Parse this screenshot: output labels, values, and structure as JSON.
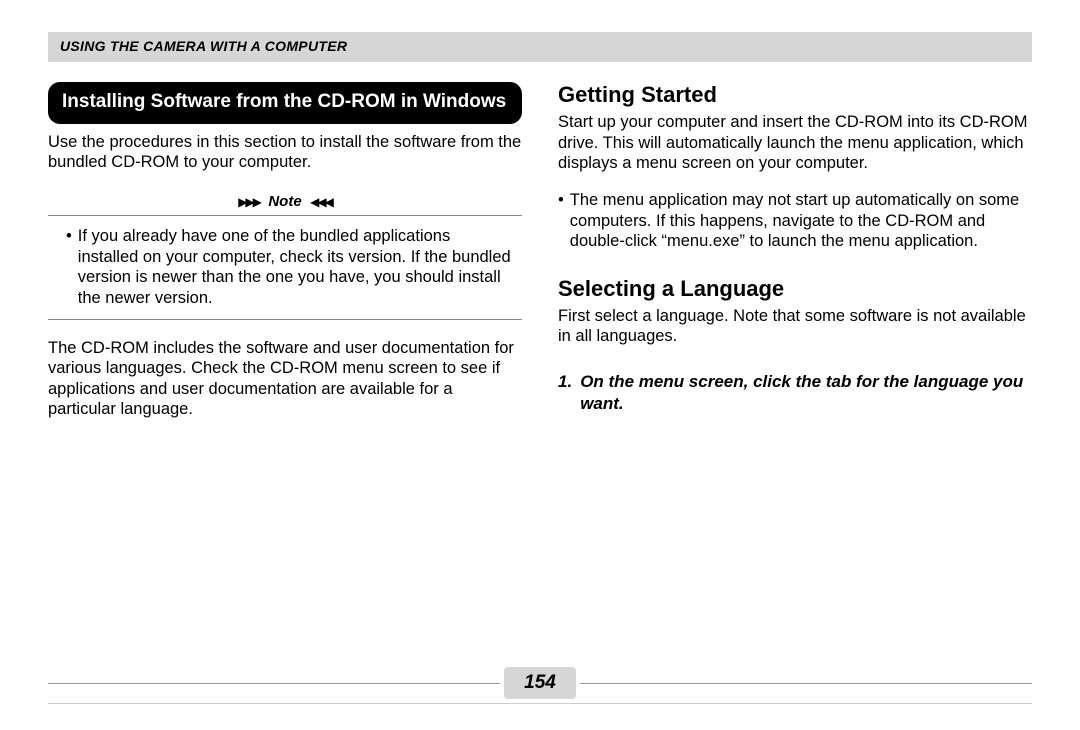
{
  "header": "USING THE CAMERA WITH A COMPUTER",
  "left": {
    "heading": "Installing Software from the CD-ROM in Windows",
    "intro": "Use the procedures in this section to install the software from the bundled CD-ROM to your computer.",
    "note_label": "Note",
    "note_bullet": "If you already have one of the bundled applications installed on your computer, check its version. If the bundled version is newer than the one you have, you should install the newer version.",
    "after_note": "The CD-ROM includes the software and user documentation for various languages. Check the CD-ROM menu screen to see if applications and user documentation are available for a particular language."
  },
  "right": {
    "heading1": "Getting Started",
    "para1": "Start up your computer and insert the CD-ROM into its CD-ROM drive. This will automatically launch the menu application, which displays a menu screen on your computer.",
    "bullet1": "The menu application may not start up automatically on some computers. If this happens, navigate to the CD-ROM and double-click “menu.exe” to launch the menu application.",
    "heading2": "Selecting a Language",
    "para2": "First select a language. Note that some software is not available in all languages.",
    "step1_num": "1.",
    "step1_text": "On the menu screen, click the tab for the language you want."
  },
  "page_number": "154"
}
